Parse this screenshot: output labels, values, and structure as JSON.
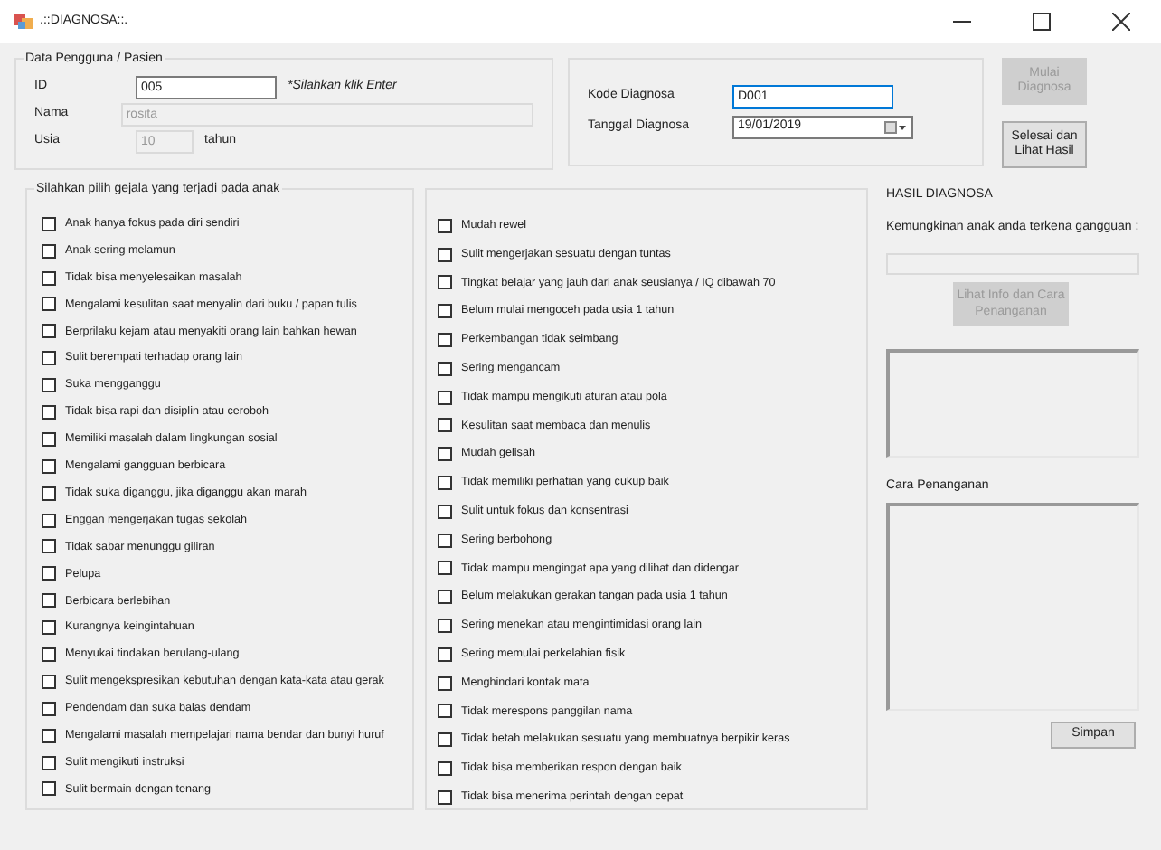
{
  "window": {
    "title": ".::DIAGNOSA::."
  },
  "patient": {
    "title": "Data Pengguna / Pasien",
    "fields": [
      {
        "label": "ID",
        "value": "005",
        "disabled": false,
        "hint": "*Silahkan klik Enter"
      },
      {
        "label": "Nama",
        "value": "rosita",
        "disabled": true
      },
      {
        "label": "Usia",
        "value": "10",
        "disabled": true,
        "unit": "tahun"
      }
    ]
  },
  "diagnosis": {
    "fields": [
      {
        "label": "Kode Diagnosa",
        "value": "D001",
        "kind": "text"
      },
      {
        "label": "Tanggal Diagnosa",
        "value": "19/01/2019",
        "kind": "date"
      }
    ]
  },
  "buttons": [
    {
      "label": "Mulai Diagnosa",
      "disabled": true
    },
    {
      "label": "Selesai dan Lihat Hasil",
      "disabled": false
    }
  ],
  "symptoms": {
    "title": "Silahkan pilih gejala yang terjadi pada anak",
    "columns": [
      [
        {
          "label": "Anak hanya fokus pada diri sendiri",
          "checked": false
        },
        {
          "label": "Anak sering melamun",
          "checked": false
        },
        {
          "label": "Tidak bisa menyelesaikan masalah",
          "checked": false
        },
        {
          "label": "Mengalami kesulitan saat menyalin dari buku / papan tulis",
          "checked": false
        },
        {
          "label": "Berprilaku kejam atau menyakiti orang lain bahkan hewan",
          "checked": false
        },
        {
          "label": "Sulit berempati terhadap orang lain",
          "checked": false
        },
        {
          "label": "Suka mengganggu",
          "checked": false
        },
        {
          "label": "Tidak bisa rapi dan disiplin atau ceroboh",
          "checked": false
        },
        {
          "label": "Memiliki masalah dalam lingkungan sosial",
          "checked": false
        },
        {
          "label": "Mengalami gangguan berbicara",
          "checked": false
        },
        {
          "label": "Tidak suka diganggu, jika diganggu akan marah",
          "checked": false
        },
        {
          "label": "Enggan mengerjakan tugas sekolah",
          "checked": false
        },
        {
          "label": "Tidak sabar menunggu giliran",
          "checked": false
        },
        {
          "label": "Pelupa",
          "checked": false
        },
        {
          "label": "Berbicara berlebihan",
          "checked": false
        },
        {
          "label": "Kurangnya keingintahuan",
          "checked": false
        },
        {
          "label": "Menyukai tindakan berulang-ulang",
          "checked": false
        },
        {
          "label": "Sulit mengekspresikan kebutuhan dengan kata-kata atau gerak",
          "checked": false
        },
        {
          "label": "Pendendam dan suka balas dendam",
          "checked": false
        },
        {
          "label": "Mengalami masalah mempelajari nama bendar dan bunyi huruf",
          "checked": false
        },
        {
          "label": "Sulit mengikuti instruksi",
          "checked": false
        },
        {
          "label": "Sulit bermain dengan tenang",
          "checked": false
        }
      ],
      [
        {
          "label": "Mudah rewel",
          "checked": false
        },
        {
          "label": "Sulit mengerjakan sesuatu dengan tuntas",
          "checked": false
        },
        {
          "label": "Tingkat belajar yang jauh dari anak seusianya / IQ dibawah 70",
          "checked": false
        },
        {
          "label": "Belum mulai mengoceh pada usia 1 tahun",
          "checked": false
        },
        {
          "label": "Perkembangan tidak seimbang",
          "checked": false
        },
        {
          "label": "Sering mengancam",
          "checked": false
        },
        {
          "label": "Tidak mampu mengikuti aturan atau pola",
          "checked": false
        },
        {
          "label": "Kesulitan saat membaca dan menulis",
          "checked": false
        },
        {
          "label": "Mudah gelisah",
          "checked": false
        },
        {
          "label": "Tidak memiliki perhatian yang cukup baik",
          "checked": false
        },
        {
          "label": "Sulit untuk fokus dan konsentrasi",
          "checked": false
        },
        {
          "label": "Sering berbohong",
          "checked": false
        },
        {
          "label": "Tidak mampu mengingat apa yang dilihat dan didengar",
          "checked": false
        },
        {
          "label": "Belum melakukan gerakan tangan pada usia 1 tahun",
          "checked": false
        },
        {
          "label": "Sering menekan atau mengintimidasi orang lain",
          "checked": false
        },
        {
          "label": "Sering memulai perkelahian fisik",
          "checked": false
        },
        {
          "label": "Menghindari kontak mata",
          "checked": false
        },
        {
          "label": "Tidak merespons panggilan nama",
          "checked": false
        },
        {
          "label": "Tidak betah melakukan sesuatu yang membuatnya berpikir keras",
          "checked": false
        },
        {
          "label": "Tidak bisa memberikan respon dengan baik",
          "checked": false
        },
        {
          "label": "Tidak bisa menerima perintah dengan cepat",
          "checked": false
        }
      ]
    ]
  },
  "result": {
    "title": "HASIL DIAGNOSA",
    "question": "Kemungkinan anak anda terkena gangguan :",
    "info_button": {
      "label": "Lihat Info dan Cara Penanganan",
      "disabled": true
    },
    "handling_label": "Cara Penanganan",
    "save_button": {
      "label": "Simpan",
      "disabled": false
    }
  }
}
